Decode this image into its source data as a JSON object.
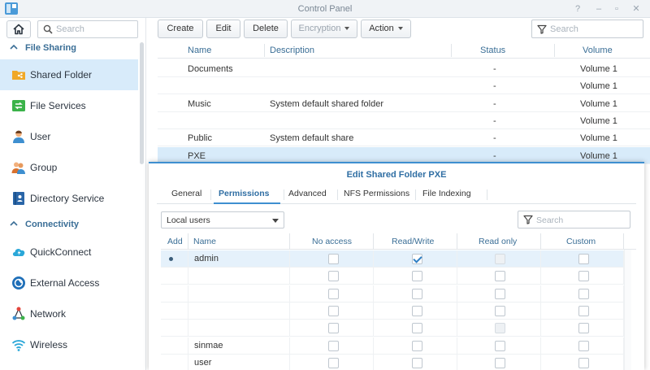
{
  "window": {
    "title": "Control Panel"
  },
  "colors": {
    "accent": "#3e8fd0",
    "selected_row": "#d8ebfa",
    "section_label": "#3a6e96"
  },
  "sidebar": {
    "search_placeholder": "Search",
    "sections": [
      {
        "label": "File Sharing",
        "icon": "chevron-up-icon"
      },
      {
        "label": "Connectivity",
        "icon": "chevron-up-icon"
      }
    ],
    "items": [
      {
        "label": "Shared Folder",
        "icon": "shared-folder-icon",
        "active": true
      },
      {
        "label": "File Services",
        "icon": "file-services-icon"
      },
      {
        "label": "User",
        "icon": "user-icon"
      },
      {
        "label": "Group",
        "icon": "group-icon"
      },
      {
        "label": "Directory Service",
        "icon": "directory-service-icon"
      },
      {
        "label": "QuickConnect",
        "icon": "quickconnect-icon"
      },
      {
        "label": "External Access",
        "icon": "external-access-icon"
      },
      {
        "label": "Network",
        "icon": "network-icon"
      },
      {
        "label": "Wireless",
        "icon": "wireless-icon"
      }
    ]
  },
  "toolbar": {
    "create": "Create",
    "edit": "Edit",
    "delete": "Delete",
    "encryption": "Encryption",
    "action": "Action",
    "search_placeholder": "Search"
  },
  "folders": {
    "columns": [
      "Name",
      "Description",
      "Status",
      "Volume"
    ],
    "rows": [
      {
        "name": "Documents",
        "description": "",
        "status": "-",
        "volume": "Volume 1"
      },
      {
        "name": "",
        "description": "",
        "status": "-",
        "volume": "Volume 1"
      },
      {
        "name": "Music",
        "description": "System default shared folder",
        "status": "-",
        "volume": "Volume 1"
      },
      {
        "name": "",
        "description": "",
        "status": "-",
        "volume": "Volume 1"
      },
      {
        "name": "Public",
        "description": "System default share",
        "status": "-",
        "volume": "Volume 1"
      },
      {
        "name": "PXE",
        "description": "",
        "status": "-",
        "volume": "Volume 1",
        "selected": true
      }
    ]
  },
  "dialog": {
    "title": "Edit Shared Folder PXE",
    "tabs": [
      "General",
      "Permissions",
      "Advanced",
      "NFS Permissions",
      "File Indexing"
    ],
    "active_tab": "Permissions",
    "user_filter": "Local users",
    "search_placeholder": "Search",
    "columns": [
      "Add",
      "Name",
      "No access",
      "Read/Write",
      "Read only",
      "Custom"
    ],
    "rows": [
      {
        "added": true,
        "name": "admin",
        "no_access": false,
        "read_write": true,
        "read_only": false,
        "read_only_disabled": true,
        "custom": false,
        "selected": true
      },
      {
        "added": false,
        "name": "",
        "no_access": false,
        "read_write": false,
        "read_only": false,
        "read_only_disabled": false,
        "custom": false
      },
      {
        "added": false,
        "name": "",
        "no_access": false,
        "read_write": false,
        "read_only": false,
        "read_only_disabled": false,
        "custom": false
      },
      {
        "added": false,
        "name": "",
        "no_access": false,
        "read_write": false,
        "read_only": false,
        "read_only_disabled": false,
        "custom": false
      },
      {
        "added": false,
        "name": "",
        "no_access": false,
        "read_write": false,
        "read_only": false,
        "read_only_disabled": true,
        "custom": false
      },
      {
        "added": false,
        "name": "sinmae",
        "no_access": false,
        "read_write": false,
        "read_only": false,
        "read_only_disabled": false,
        "custom": false
      },
      {
        "added": false,
        "name": "user",
        "no_access": false,
        "read_write": false,
        "read_only": false,
        "read_only_disabled": false,
        "custom": false
      }
    ]
  }
}
